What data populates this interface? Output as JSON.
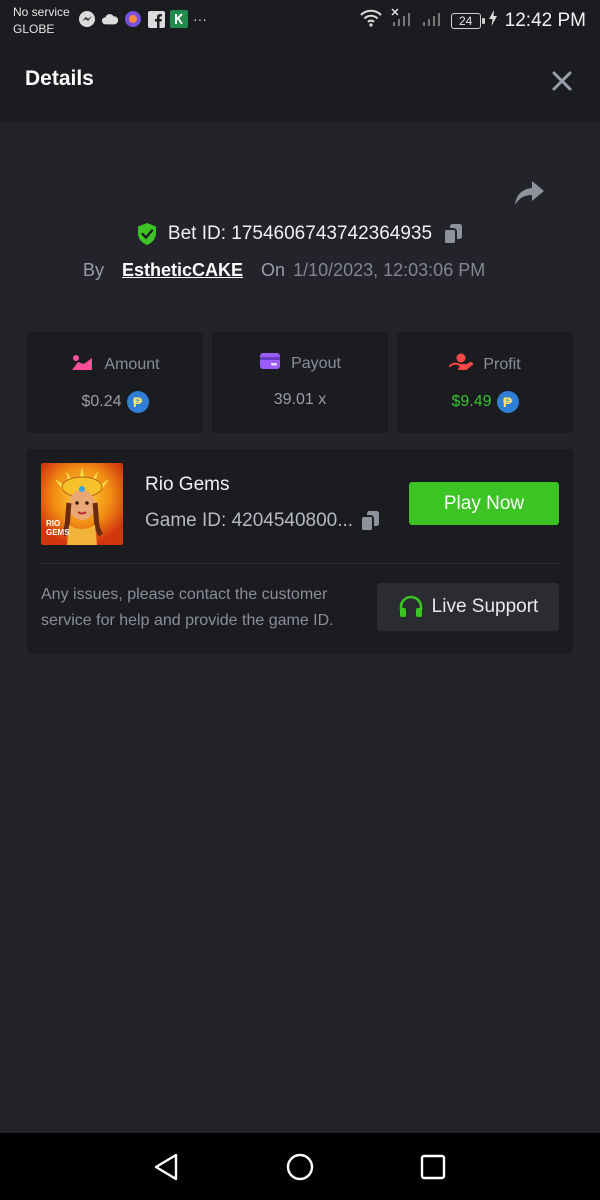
{
  "status_bar": {
    "carrier_line1": "No service",
    "carrier_line2": "GLOBE",
    "more": "···",
    "battery": "24",
    "time": "12:42 PM"
  },
  "header": {
    "title": "Details"
  },
  "bet": {
    "bet_id_label": "Bet ID:",
    "bet_id": "1754606743742364935",
    "by_label": "By",
    "username": "EstheticCAKE",
    "on_label": "On",
    "datetime": "1/10/2023, 12:03:06 PM"
  },
  "stats": {
    "amount": {
      "label": "Amount",
      "value": "$0.24",
      "icon_color": "#ff4f9a"
    },
    "payout": {
      "label": "Payout",
      "value": "39.01 x",
      "icon_color": "#9b5cff"
    },
    "profit": {
      "label": "Profit",
      "value": "$9.49",
      "icon_color": "#ff4747",
      "value_color": "#37c22f"
    }
  },
  "currency_symbol": "₱",
  "game": {
    "name": "Rio Gems",
    "game_id": "Game ID: 4204540800...",
    "thumb_text": "RIO GEMS",
    "play_label": "Play Now"
  },
  "support": {
    "message": "Any issues, please contact the customer service for help and provide the game ID.",
    "button_label": "Live Support"
  },
  "colors": {
    "accent_green": "#3cc424",
    "background": "#232429",
    "panel": "#1b1c20",
    "coin_blue": "#2f7fd6"
  }
}
